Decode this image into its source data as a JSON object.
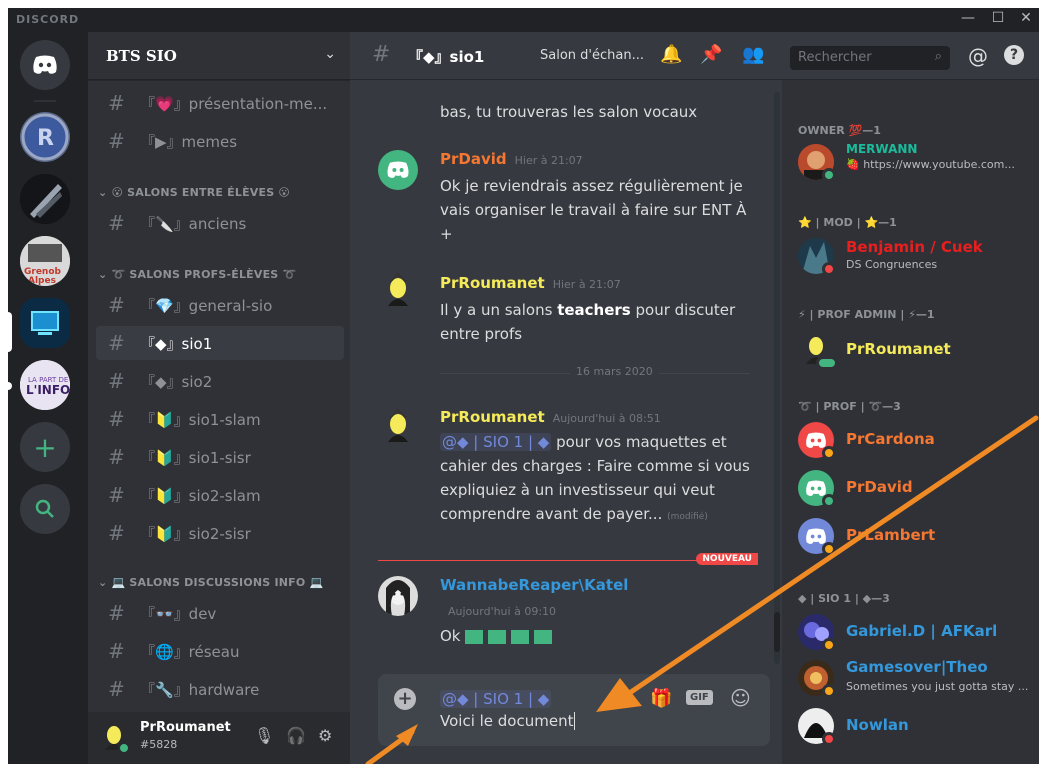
{
  "app": {
    "brand": "DISCORD",
    "controls": [
      "—",
      "☐",
      "✕"
    ]
  },
  "guild": {
    "name": "BTS SIO"
  },
  "channels": {
    "items": [
      {
        "label": "『💗』présentation-me...",
        "active": false
      },
      {
        "label": "『▶』memes",
        "active": false
      },
      {
        "label": "『🔪』anciens",
        "active": false
      },
      {
        "label": "『💎』general-sio",
        "active": false
      },
      {
        "label": "『◆』sio1",
        "active": true
      },
      {
        "label": "『◆』sio2",
        "active": false
      },
      {
        "label": "『🔰』sio1-slam",
        "active": false
      },
      {
        "label": "『🔰』sio1-sisr",
        "active": false
      },
      {
        "label": "『🔰』sio2-slam",
        "active": false
      },
      {
        "label": "『🔰』sio2-sisr",
        "active": false
      },
      {
        "label": "『👓』dev",
        "active": false
      },
      {
        "label": "『🌐』réseau",
        "active": false
      },
      {
        "label": "『🔧』hardware",
        "active": false
      }
    ],
    "categories": [
      "😮 SALONS ENTRE ÉLÈVES 😮",
      "➰ SALONS PROFS-ÉLÈVES ➰",
      "💻 SALONS DISCUSSIONS INFO 💻"
    ]
  },
  "user": {
    "name": "PrRoumanet",
    "tag": "#5828"
  },
  "chat": {
    "channel_name": "『◆』sio1",
    "topic": "Salon d'échan...",
    "search_placeholder": "Rechercher",
    "partial_text": "bas, tu trouveras les salon vocaux",
    "messages": [
      {
        "author": "PrDavid",
        "time": "Hier à 21:07",
        "text": "Ok  je reviendrais assez régulièrement  je vais organiser le travail à faire sur ENT À +",
        "color": "#f57731"
      },
      {
        "author": "PrRoumanet",
        "time": "Hier à 21:07",
        "text_before": "Il y a un salons ",
        "text_bold": "teachers",
        "text_after": " pour discuter entre profs",
        "color": "#f5ea5a"
      },
      {
        "author": "PrRoumanet",
        "time": "Aujourd'hui à 08:51",
        "mention": "@◆ | SIO 1 | ◆",
        "text": " pour vos maquettes et cahier des charges : Faire comme si vous expliquiez à un investisseur qui veut comprendre avant de payer...",
        "edited": "(modifié)",
        "color": "#f5ea5a"
      },
      {
        "author": "WannabeReaper\\Katel",
        "time": "Aujourd'hui à 09:10",
        "text": "Ok",
        "color": "#3498db"
      }
    ],
    "date_divider": "16 mars 2020",
    "new_badge": "NOUVEAU",
    "composer": {
      "mention": "@◆ | SIO 1 | ◆",
      "text": "Voici le document",
      "gif": "GIF"
    }
  },
  "members": {
    "groups": [
      {
        "label": "OWNER 💯—1"
      },
      {
        "label": "⭐ | MOD | ⭐—1"
      },
      {
        "label": "⚡ | PROF ADMIN | ⚡—1"
      },
      {
        "label": "➰ | PROF | ➰—3"
      },
      {
        "label": "◆ | SIO 1 | ◆—3"
      }
    ],
    "list": [
      {
        "name": "MERWANN",
        "status": "🍓 https://www.youtube.com...",
        "color": "#1abc9c"
      },
      {
        "name": "Benjamin / Cuek",
        "status": "DS Congruences",
        "color": "#e91e1e"
      },
      {
        "name": "PrRoumanet",
        "status": "",
        "color": "#f5ea5a"
      },
      {
        "name": "PrCardona",
        "status": "",
        "color": "#f57731"
      },
      {
        "name": "PrDavid",
        "status": "",
        "color": "#f57731"
      },
      {
        "name": "PrLambert",
        "status": "",
        "color": "#f57731"
      },
      {
        "name": "Gabriel.D | AFKarl",
        "status": "",
        "color": "#3498db"
      },
      {
        "name": "Gamesover|Theo",
        "status": "Sometimes you just gotta stay ...",
        "color": "#3498db"
      },
      {
        "name": "Nowlan",
        "status": "",
        "color": "#3498db"
      }
    ]
  },
  "colors": {
    "accent": "#7289da",
    "online": "#43b581",
    "dnd": "#f04747",
    "idle": "#faa61a",
    "arrow": "#f08a24"
  }
}
